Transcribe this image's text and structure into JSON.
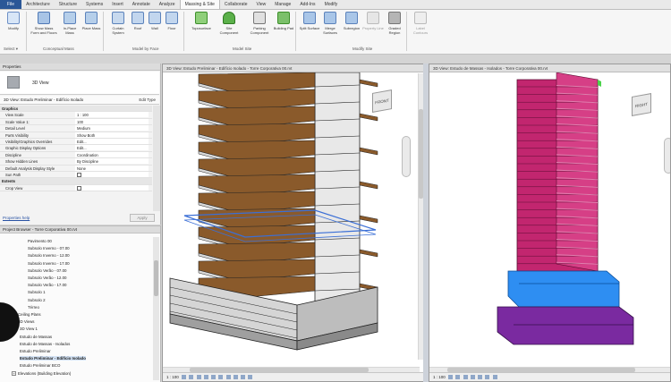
{
  "ribbon_tabs": [
    "File",
    "Architecture",
    "Structure",
    "Systems",
    "Insert",
    "Annotate",
    "Analyze",
    "Massing & Site",
    "Collaborate",
    "View",
    "Manage",
    "Add-Ins",
    "Modify"
  ],
  "ribbon_buttons": {
    "modify": "Modify",
    "show_mass": "Show Mass Form and Floors",
    "in_place_mass": "In-Place Mass",
    "place_mass": "Place Mass",
    "curtain_system": "Curtain System",
    "roof": "Roof",
    "wall": "Wall",
    "floor": "Floor",
    "toposurface": "Toposurface",
    "site_component": "Site Component",
    "parking_component": "Parking Component",
    "building_pad": "Building Pad",
    "split_surface": "Split Surface",
    "merge_surfaces": "Merge Surfaces",
    "subregion": "Subregion",
    "property_line": "Property Line",
    "graded_region": "Graded Region",
    "label_contours": "Label Contours"
  },
  "ribbon_groups": {
    "select": "Select ▾",
    "conceptual_mass": "Conceptual Mass",
    "model_by_face": "Model by Face",
    "model_site": "Model Site",
    "modify_site": "Modify Site"
  },
  "properties": {
    "title": "Properties",
    "type_name": "3D View",
    "view_selector": "3D View: Estudo Preliminar - Edifício Isolado",
    "edit_type": "Edit Type",
    "rows": [
      {
        "k": "Graphics",
        "cat": true
      },
      {
        "k": "View Scale",
        "v": "1 : 100"
      },
      {
        "k": "Scale Value    1:",
        "v": "100"
      },
      {
        "k": "Detail Level",
        "v": "Medium"
      },
      {
        "k": "Parts Visibility",
        "v": "Show Both"
      },
      {
        "k": "Visibility/Graphics Overrides",
        "v": "Edit..."
      },
      {
        "k": "Graphic Display Options",
        "v": "Edit..."
      },
      {
        "k": "Discipline",
        "v": "Coordination"
      },
      {
        "k": "Show Hidden Lines",
        "v": "By Discipline"
      },
      {
        "k": "Default Analysis Display Style",
        "v": "None"
      },
      {
        "k": "Sun Path",
        "v": "",
        "check": true
      },
      {
        "k": "Extents",
        "cat": true
      },
      {
        "k": "Crop View",
        "v": "",
        "check": true
      }
    ],
    "help_link": "Properties help",
    "apply": "Apply"
  },
  "project_browser": {
    "title": "Project Browser - Torre Corporativa 00.rvt",
    "items": [
      {
        "label": "Pavimento 00",
        "indent": 3
      },
      {
        "label": "Subsolo Inverno - 07.00",
        "indent": 3
      },
      {
        "label": "Subsolo Inverno - 12.00",
        "indent": 3
      },
      {
        "label": "Subsolo Inverno - 17.00",
        "indent": 3
      },
      {
        "label": "Subsolo Verão - 07.00",
        "indent": 3
      },
      {
        "label": "Subsolo Verão - 12.00",
        "indent": 3
      },
      {
        "label": "Subsolo Verão - 17.00",
        "indent": 3
      },
      {
        "label": "Subsolo 1",
        "indent": 3
      },
      {
        "label": "Subsolo 2",
        "indent": 3
      },
      {
        "label": "Térreo",
        "indent": 3
      },
      {
        "label": "Ceiling Plans",
        "indent": 1,
        "toggle": "+"
      },
      {
        "label": "3D Views",
        "indent": 1,
        "toggle": "−"
      },
      {
        "label": "3D View 1",
        "indent": 2
      },
      {
        "label": "Estudo de Massas",
        "indent": 2
      },
      {
        "label": "Estudo de Massas - Isolados",
        "indent": 2
      },
      {
        "label": "Estudo Preliminar",
        "indent": 2
      },
      {
        "label": "Estudo Preliminar - Edifício Isolado",
        "indent": 2,
        "selected": true
      },
      {
        "label": "Estudo Preliminar BCO",
        "indent": 2
      },
      {
        "label": "Elevations (Building Elevation)",
        "indent": 1,
        "toggle": "+"
      }
    ]
  },
  "viewports": {
    "left_title": "3D View: Estudo Preliminar - Edifício Isolado - Torre Corporativa 00.rvt",
    "right_title": "3D View: Estudo de Massas - Isolados - Torre Corporativa 00.rvt",
    "left_scale": "1 : 100",
    "right_scale": "1 : 100",
    "cube_label": "FRONT",
    "cube_label_right": "RIGHT"
  },
  "colors": {
    "wood": "#8a5a2b",
    "slab": "#d9d9d9",
    "magenta": "#c2266f",
    "green": "#4bd34b",
    "blue": "#2e8ef2",
    "purple": "#7a2aa0",
    "selection": "#3b6fd6"
  }
}
